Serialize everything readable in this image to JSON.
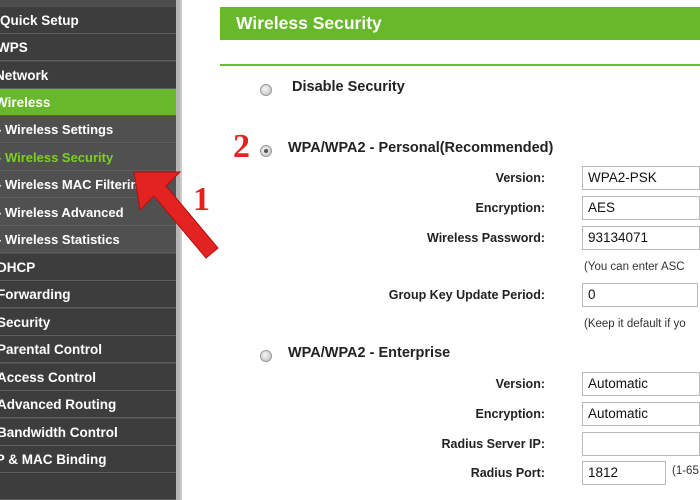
{
  "sidebar": {
    "items": [
      {
        "label": "Quick Setup"
      },
      {
        "label": "WPS"
      },
      {
        "label": "Network"
      },
      {
        "label": "Wireless"
      },
      {
        "label": "- Wireless Settings"
      },
      {
        "label": "- Wireless Security"
      },
      {
        "label": "- Wireless MAC Filtering"
      },
      {
        "label": "- Wireless Advanced"
      },
      {
        "label": "- Wireless Statistics"
      },
      {
        "label": "DHCP"
      },
      {
        "label": "Forwarding"
      },
      {
        "label": "Security"
      },
      {
        "label": "Parental Control"
      },
      {
        "label": "Access Control"
      },
      {
        "label": "Advanced Routing"
      },
      {
        "label": "Bandwidth Control"
      },
      {
        "label": "IP & MAC Binding"
      }
    ]
  },
  "page": {
    "title": "Wireless Security",
    "disable": {
      "label": "Disable Security"
    },
    "personal": {
      "label": "WPA/WPA2 - Personal(Recommended)",
      "version_label": "Version:",
      "version_value": "WPA2-PSK",
      "encryption_label": "Encryption:",
      "encryption_value": "AES",
      "password_label": "Wireless Password:",
      "password_value": "93134071",
      "password_hint": "(You can enter ASC",
      "group_key_label": "Group Key Update Period:",
      "group_key_value": "0",
      "group_key_hint": "(Keep it default if yo"
    },
    "enterprise": {
      "label": "WPA/WPA2 - Enterprise",
      "version_label": "Version:",
      "version_value": "Automatic",
      "encryption_label": "Encryption:",
      "encryption_value": "Automatic",
      "radius_ip_label": "Radius Server IP:",
      "radius_ip_value": "",
      "radius_port_label": "Radius Port:",
      "radius_port_value": "1812",
      "radius_port_hint": "(1-65"
    }
  },
  "annotations": {
    "step1": "1",
    "step2": "2"
  },
  "colors": {
    "accent": "#67b82a",
    "annotation": "#e32222",
    "sidebar": "#3d3d3d"
  }
}
